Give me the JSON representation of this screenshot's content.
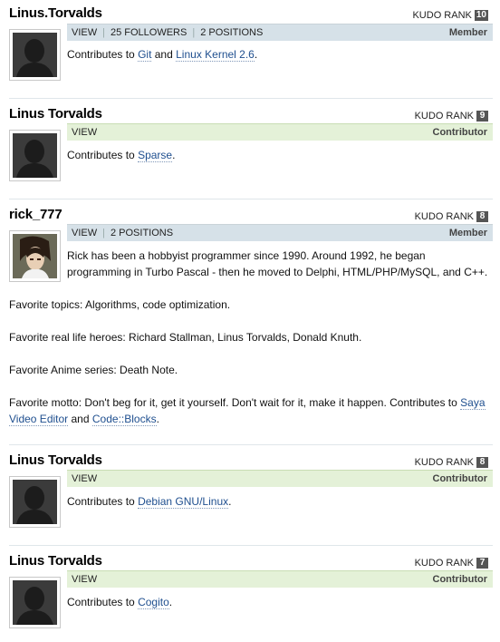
{
  "entries": [
    {
      "name": "Linus.Torvalds",
      "kudo_label": "KUDO RANK",
      "kudo_rank": "10",
      "bar_links": [
        "VIEW",
        "25 FOLLOWERS",
        "2 POSITIONS"
      ],
      "role": "Member",
      "contributes_prefix": "Contributes to",
      "projects": [
        "Git",
        "Linux Kernel 2.6"
      ],
      "join": "and",
      "suffix": "."
    },
    {
      "name": "Linus Torvalds",
      "kudo_label": "KUDO RANK",
      "kudo_rank": "9",
      "bar_links": [
        "VIEW"
      ],
      "role": "Contributor",
      "contributes_prefix": "Contributes to",
      "projects": [
        "Sparse"
      ],
      "suffix": "."
    },
    {
      "name": "rick_777",
      "kudo_label": "KUDO RANK",
      "kudo_rank": "8",
      "bar_links": [
        "VIEW",
        "2 POSITIONS"
      ],
      "role": "Member",
      "bio_line1": "Rick has been a hobbyist programmer since 1990. Around 1992, he began",
      "bio_line2": "programming in Turbo Pascal - then he moved to Delphi, HTML/PHP/MySQL, and C++.",
      "topics": "Favorite topics: Algorithms, code optimization.",
      "heroes": "Favorite real life heroes: Richard Stallman, Linus Torvalds, Donald Knuth.",
      "anime": "Favorite Anime series: Death Note.",
      "motto": "Favorite motto: Don't beg for it, get it yourself. Don't wait for it, make it happen. Contributes to",
      "projects": [
        "Saya Video Editor",
        "Code::Blocks"
      ],
      "join": "and",
      "suffix": "."
    },
    {
      "name": "Linus Torvalds",
      "kudo_label": "KUDO RANK",
      "kudo_rank": "8",
      "bar_links": [
        "VIEW"
      ],
      "role": "Contributor",
      "contributes_prefix": "Contributes to",
      "projects": [
        "Debian GNU/Linux"
      ],
      "suffix": "."
    },
    {
      "name": "Linus Torvalds",
      "kudo_label": "KUDO RANK",
      "kudo_rank": "7",
      "bar_links": [
        "VIEW"
      ],
      "role": "Contributor",
      "contributes_prefix": "Contributes to",
      "projects": [
        "Cogito"
      ],
      "suffix": "."
    }
  ],
  "colors": {
    "member_bar": "#d6e1e8",
    "contributor_bar": "#e4f1d8",
    "link": "#1f4f8f",
    "rank_badge": "#555555"
  },
  "icons": {
    "default_avatar": "silhouette-avatar-icon",
    "rick_avatar": "anime-avatar-icon"
  }
}
